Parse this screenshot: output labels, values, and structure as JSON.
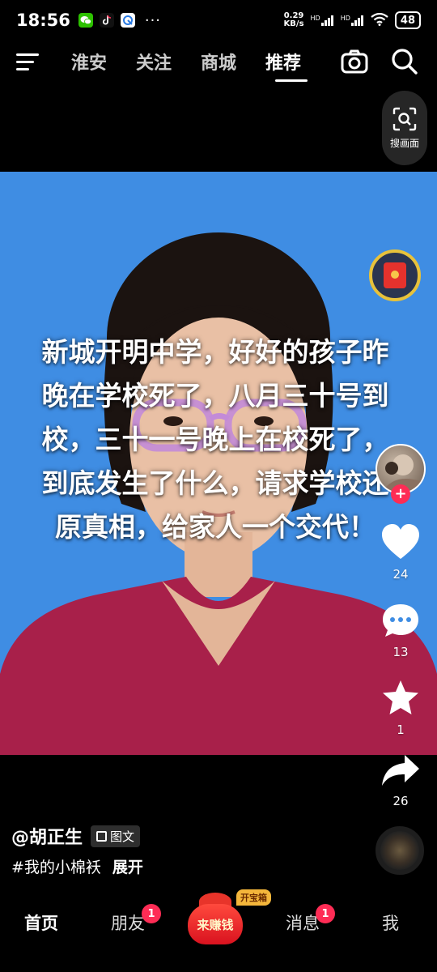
{
  "status_bar": {
    "time": "18:56",
    "apps": [
      "wechat-icon",
      "tiktok-icon",
      "browser-icon"
    ],
    "more": "···",
    "net_speed_value": "0.29",
    "net_speed_unit": "KB/s",
    "signal_label_1": "HD",
    "signal_label_2": "HD",
    "battery": "48"
  },
  "top_nav": {
    "tabs": [
      {
        "label": "淮安"
      },
      {
        "label": "关注"
      },
      {
        "label": "商城"
      },
      {
        "label": "推荐"
      }
    ],
    "active_tab": "推荐"
  },
  "search_scene": {
    "label": "搜画面"
  },
  "video": {
    "overlay_text": "新城开明中学，好好的孩子昨晚在学校死了，八月三十号到校，三十一号晚上在校死了，到底发生了什么，请求学校还原真相，给家人一个交代！",
    "background_color": "#3f8de3"
  },
  "side_rail": {
    "likes": "24",
    "comments": "13",
    "favorites": "1",
    "shares": "26"
  },
  "post": {
    "author": "@胡正生",
    "type_badge": "图文",
    "hashtag": "#我的小棉袄",
    "expand_label": "展开"
  },
  "bottom_nav": {
    "home": "首页",
    "friends": "朋友",
    "friends_badge": "1",
    "earn_label": "来赚钱",
    "earn_tag": "开宝箱",
    "messages": "消息",
    "messages_badge": "1",
    "me": "我"
  },
  "colors": {
    "accent_red": "#fe2c55",
    "gold": "#e8c23a"
  }
}
